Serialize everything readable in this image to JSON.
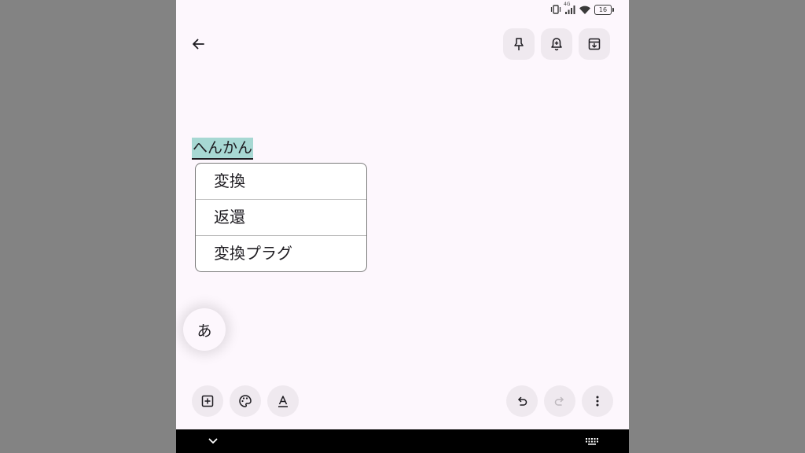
{
  "status_bar": {
    "battery_level": "16",
    "network_label": "4G",
    "icons": [
      "vibrate-icon",
      "signal-icon",
      "wifi-icon",
      "battery-icon"
    ]
  },
  "toolbar": {
    "back_icon": "arrow-left-icon",
    "pin_icon": "pin-icon",
    "reminder_icon": "bell-plus-icon",
    "archive_icon": "archive-icon"
  },
  "note": {
    "composing_text": "へんかん"
  },
  "conversion_menu": {
    "items": [
      "変換",
      "返還",
      "変換プラグ"
    ]
  },
  "ime_indicator": {
    "label": "あ"
  },
  "bottom_toolbar": {
    "add_icon": "add-box-icon",
    "palette_icon": "palette-icon",
    "text_format_icon": "text-format-icon",
    "undo_icon": "undo-icon",
    "redo_icon": "redo-icon",
    "more_icon": "more-vert-icon"
  },
  "colors": {
    "background": "#fdf7fd",
    "button_bg": "#efe9ef",
    "highlight": "#a7d8d3",
    "outer": "#838383"
  }
}
